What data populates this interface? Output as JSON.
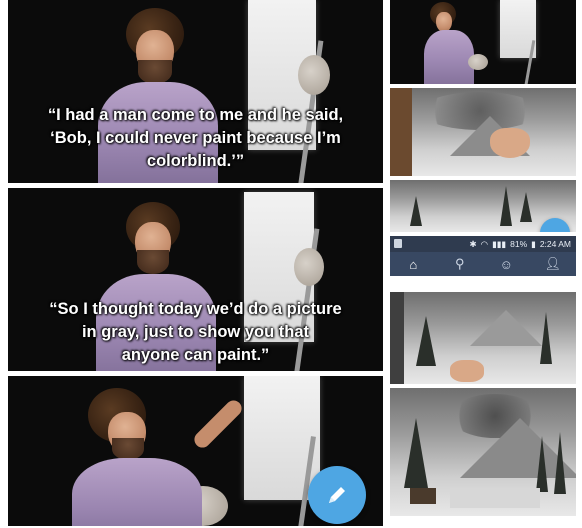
{
  "left_panels": [
    {
      "caption_lines": [
        "“I had a man come to me and he said,",
        "‘Bob, I could never paint because I’m",
        "colorblind.’”"
      ]
    },
    {
      "caption_lines": [
        "“So I thought today we’d do a picture",
        "in gray, just to show you that",
        "anyone can paint.”"
      ]
    },
    {
      "caption_lines": []
    }
  ],
  "phone": {
    "status": {
      "signal_glyph": "▮▮▮",
      "battery_text": "81%",
      "time_text": "2:24 AM"
    },
    "nav_icons": [
      "home-icon",
      "search-icon",
      "emoji-icon",
      "profile-icon"
    ]
  },
  "colors": {
    "fab": "#4ea6e3",
    "status_bar": "#2f3b4f",
    "nav_bar": "#384862"
  }
}
